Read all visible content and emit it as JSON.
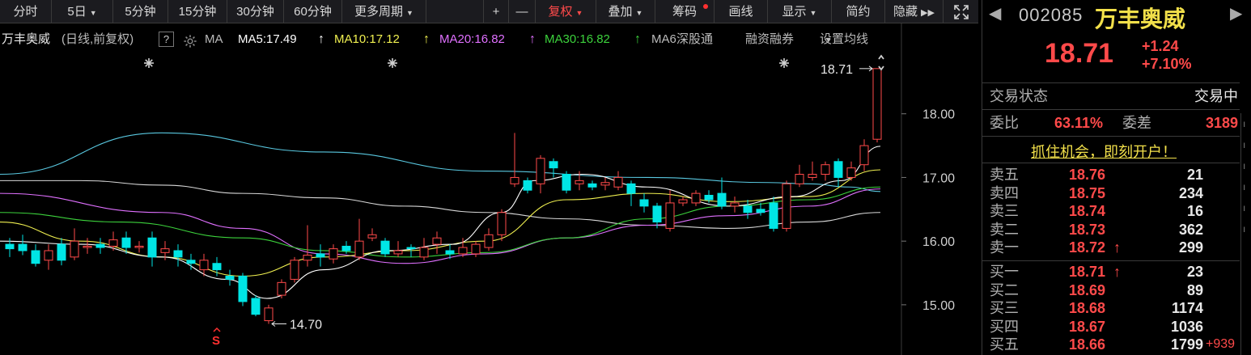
{
  "toolbar": {
    "items": [
      {
        "label": "分时"
      },
      {
        "label": "5日",
        "dropdown": true
      },
      {
        "label": "5分钟"
      },
      {
        "label": "15分钟"
      },
      {
        "label": "30分钟"
      },
      {
        "label": "60分钟"
      },
      {
        "label": "更多周期",
        "dropdown": true
      }
    ],
    "zoom_in": "+",
    "zoom_out": "—",
    "fuquan": "复权",
    "diejia": "叠加",
    "chouma": "筹码",
    "huaxian": "画线",
    "xianshi": "显示",
    "jianyue": "简约",
    "yincang": "隐藏",
    "fullscreen_icon": "fullscreen-icon"
  },
  "indicator_line": {
    "stock_name": "万丰奥威",
    "period_label": "(日线,前复权)",
    "help": "?",
    "ma_label": "MA",
    "ma5": "MA5:17.49",
    "ma10": "MA10:17.12",
    "ma20": "MA20:16.82",
    "ma30": "MA30:16.82",
    "ma6": "MA6",
    "shengutong": "深股通",
    "rongzi": "融资融券",
    "settings": "设置均线",
    "up_arrow": "↑"
  },
  "chart_data": {
    "type": "candlestick",
    "y_ticks": [
      "18.00",
      "17.00",
      "16.00",
      "15.00"
    ],
    "ylim": [
      14.3,
      19.0
    ],
    "high_label": "18.71",
    "low_label": "14.70",
    "signal_label": "S",
    "candles": [
      {
        "o": 15.95,
        "c": 15.88,
        "h": 16.05,
        "l": 15.75
      },
      {
        "o": 15.95,
        "c": 15.85,
        "h": 16.1,
        "l": 15.78
      },
      {
        "o": 15.85,
        "c": 15.65,
        "h": 15.95,
        "l": 15.6
      },
      {
        "o": 15.7,
        "c": 15.85,
        "h": 15.95,
        "l": 15.55
      },
      {
        "o": 15.95,
        "c": 15.7,
        "h": 16.05,
        "l": 15.62
      },
      {
        "o": 15.75,
        "c": 16.0,
        "h": 16.2,
        "l": 15.7
      },
      {
        "o": 15.9,
        "c": 15.92,
        "h": 16.05,
        "l": 15.8
      },
      {
        "o": 15.95,
        "c": 15.9,
        "h": 16.05,
        "l": 15.8
      },
      {
        "o": 15.92,
        "c": 16.02,
        "h": 16.15,
        "l": 15.85
      },
      {
        "o": 16.05,
        "c": 15.9,
        "h": 16.15,
        "l": 15.8
      },
      {
        "o": 15.9,
        "c": 15.92,
        "h": 16.0,
        "l": 15.82
      },
      {
        "o": 16.05,
        "c": 15.75,
        "h": 16.15,
        "l": 15.6
      },
      {
        "o": 15.82,
        "c": 15.88,
        "h": 16.0,
        "l": 15.7
      },
      {
        "o": 15.85,
        "c": 15.75,
        "h": 15.95,
        "l": 15.6
      },
      {
        "o": 15.7,
        "c": 15.65,
        "h": 15.8,
        "l": 15.55
      },
      {
        "o": 15.55,
        "c": 15.7,
        "h": 15.8,
        "l": 15.45
      },
      {
        "o": 15.65,
        "c": 15.55,
        "h": 15.75,
        "l": 15.45
      },
      {
        "o": 15.45,
        "c": 15.4,
        "h": 15.55,
        "l": 15.3
      },
      {
        "o": 15.45,
        "c": 15.05,
        "h": 15.5,
        "l": 14.98
      },
      {
        "o": 15.1,
        "c": 14.85,
        "h": 15.15,
        "l": 14.82
      },
      {
        "o": 14.75,
        "c": 14.95,
        "h": 15.0,
        "l": 14.7
      },
      {
        "o": 15.15,
        "c": 15.35,
        "h": 15.4,
        "l": 15.1
      },
      {
        "o": 15.4,
        "c": 15.7,
        "h": 15.75,
        "l": 15.35
      },
      {
        "o": 15.7,
        "c": 15.78,
        "h": 16.25,
        "l": 15.6
      },
      {
        "o": 15.8,
        "c": 15.75,
        "h": 15.95,
        "l": 15.6
      },
      {
        "o": 15.72,
        "c": 15.88,
        "h": 15.95,
        "l": 15.65
      },
      {
        "o": 15.92,
        "c": 15.85,
        "h": 16.0,
        "l": 15.8
      },
      {
        "o": 15.75,
        "c": 16.0,
        "h": 16.35,
        "l": 15.7
      },
      {
        "o": 16.05,
        "c": 16.1,
        "h": 16.2,
        "l": 16.0
      },
      {
        "o": 16.0,
        "c": 15.8,
        "h": 16.05,
        "l": 15.75
      },
      {
        "o": 15.8,
        "c": 15.85,
        "h": 16.0,
        "l": 15.75
      },
      {
        "o": 15.9,
        "c": 15.88,
        "h": 15.95,
        "l": 15.75
      },
      {
        "o": 15.75,
        "c": 15.9,
        "h": 16.05,
        "l": 15.7
      },
      {
        "o": 15.95,
        "c": 16.05,
        "h": 16.15,
        "l": 15.8
      },
      {
        "o": 15.85,
        "c": 15.8,
        "h": 15.95,
        "l": 15.72
      },
      {
        "o": 15.8,
        "c": 15.9,
        "h": 16.05,
        "l": 15.75
      },
      {
        "o": 15.8,
        "c": 15.95,
        "h": 16.0,
        "l": 15.75
      },
      {
        "o": 15.9,
        "c": 16.1,
        "h": 16.2,
        "l": 15.85
      },
      {
        "o": 16.1,
        "c": 16.45,
        "h": 16.5,
        "l": 16.0
      },
      {
        "o": 16.9,
        "c": 17.0,
        "h": 17.7,
        "l": 16.85
      },
      {
        "o": 16.95,
        "c": 16.8,
        "h": 17.0,
        "l": 16.75
      },
      {
        "o": 16.9,
        "c": 17.3,
        "h": 17.35,
        "l": 16.75
      },
      {
        "o": 17.25,
        "c": 17.15,
        "h": 17.3,
        "l": 17.0
      },
      {
        "o": 17.05,
        "c": 16.8,
        "h": 17.1,
        "l": 16.75
      },
      {
        "o": 16.9,
        "c": 16.95,
        "h": 17.1,
        "l": 16.8
      },
      {
        "o": 16.9,
        "c": 16.85,
        "h": 16.95,
        "l": 16.8
      },
      {
        "o": 16.88,
        "c": 16.92,
        "h": 17.0,
        "l": 16.8
      },
      {
        "o": 16.85,
        "c": 17.0,
        "h": 17.1,
        "l": 16.8
      },
      {
        "o": 16.9,
        "c": 16.75,
        "h": 16.95,
        "l": 16.55
      },
      {
        "o": 16.65,
        "c": 16.55,
        "h": 16.75,
        "l": 16.45
      },
      {
        "o": 16.55,
        "c": 16.3,
        "h": 16.6,
        "l": 16.2
      },
      {
        "o": 16.2,
        "c": 16.6,
        "h": 16.8,
        "l": 16.15
      },
      {
        "o": 16.6,
        "c": 16.65,
        "h": 16.7,
        "l": 16.55
      },
      {
        "o": 16.6,
        "c": 16.75,
        "h": 16.8,
        "l": 16.55
      },
      {
        "o": 16.72,
        "c": 16.65,
        "h": 16.8,
        "l": 16.6
      },
      {
        "o": 16.75,
        "c": 16.55,
        "h": 17.0,
        "l": 16.5
      },
      {
        "o": 16.55,
        "c": 16.6,
        "h": 16.7,
        "l": 16.45
      },
      {
        "o": 16.55,
        "c": 16.45,
        "h": 16.65,
        "l": 16.35
      },
      {
        "o": 16.5,
        "c": 16.45,
        "h": 16.6,
        "l": 16.4
      },
      {
        "o": 16.6,
        "c": 16.2,
        "h": 16.7,
        "l": 16.15
      },
      {
        "o": 16.2,
        "c": 16.9,
        "h": 16.95,
        "l": 16.15
      },
      {
        "o": 16.9,
        "c": 17.05,
        "h": 17.2,
        "l": 16.85
      },
      {
        "o": 17.0,
        "c": 17.05,
        "h": 17.25,
        "l": 16.95
      },
      {
        "o": 17.05,
        "c": 17.2,
        "h": 17.25,
        "l": 16.95
      },
      {
        "o": 17.25,
        "c": 17.0,
        "h": 17.3,
        "l": 16.85
      },
      {
        "o": 17.0,
        "c": 17.15,
        "h": 17.25,
        "l": 16.95
      },
      {
        "o": 17.2,
        "c": 17.5,
        "h": 17.6,
        "l": 17.1
      },
      {
        "o": 17.6,
        "c": 18.71,
        "h": 18.71,
        "l": 17.55
      }
    ],
    "ma_series": [
      {
        "color": "#59c8e0",
        "points": [
          [
            0,
            17.05
          ],
          [
            200,
            17.7
          ],
          [
            400,
            17.4
          ],
          [
            600,
            17.1
          ],
          [
            800,
            17.0
          ],
          [
            950,
            16.92
          ],
          [
            1000,
            16.9
          ],
          [
            1050,
            16.85
          ],
          [
            1088,
            16.78
          ]
        ]
      },
      {
        "color": "#d8d8d8",
        "points": [
          [
            0,
            16.95
          ],
          [
            100,
            16.95
          ],
          [
            200,
            16.88
          ],
          [
            300,
            16.75
          ],
          [
            400,
            16.68
          ],
          [
            500,
            16.55
          ],
          [
            600,
            16.45
          ],
          [
            700,
            16.35
          ],
          [
            800,
            16.25
          ],
          [
            900,
            16.2
          ],
          [
            1000,
            16.3
          ],
          [
            1088,
            16.45
          ]
        ]
      },
      {
        "color": "#e070ff",
        "points": [
          [
            0,
            16.75
          ],
          [
            200,
            16.45
          ],
          [
            300,
            16.2
          ],
          [
            400,
            15.8
          ],
          [
            500,
            15.65
          ],
          [
            600,
            15.8
          ],
          [
            700,
            16.05
          ],
          [
            800,
            16.25
          ],
          [
            900,
            16.4
          ],
          [
            1000,
            16.55
          ],
          [
            1088,
            16.82
          ]
        ]
      },
      {
        "color": "#3cd23c",
        "points": [
          [
            0,
            16.45
          ],
          [
            150,
            16.3
          ],
          [
            300,
            16.05
          ],
          [
            400,
            15.85
          ],
          [
            500,
            15.75
          ],
          [
            600,
            15.82
          ],
          [
            700,
            16.05
          ],
          [
            800,
            16.35
          ],
          [
            900,
            16.55
          ],
          [
            1000,
            16.65
          ],
          [
            1088,
            16.85
          ]
        ]
      },
      {
        "color": "#f0f050",
        "points": [
          [
            0,
            16.3
          ],
          [
            100,
            16.0
          ],
          [
            200,
            15.75
          ],
          [
            300,
            15.45
          ],
          [
            400,
            15.75
          ],
          [
            500,
            15.85
          ],
          [
            600,
            16.0
          ],
          [
            700,
            16.65
          ],
          [
            800,
            16.75
          ],
          [
            900,
            16.62
          ],
          [
            1000,
            16.7
          ],
          [
            1088,
            17.12
          ]
        ]
      },
      {
        "color": "#ffffff",
        "points": [
          [
            0,
            16.0
          ],
          [
            100,
            15.95
          ],
          [
            200,
            15.75
          ],
          [
            280,
            15.4
          ],
          [
            330,
            15.1
          ],
          [
            400,
            15.55
          ],
          [
            480,
            15.85
          ],
          [
            560,
            15.95
          ],
          [
            620,
            16.45
          ],
          [
            660,
            16.95
          ],
          [
            720,
            17.05
          ],
          [
            800,
            16.85
          ],
          [
            900,
            16.55
          ],
          [
            980,
            16.7
          ],
          [
            1040,
            16.95
          ],
          [
            1088,
            17.49
          ]
        ]
      }
    ]
  },
  "quote": {
    "code": "002085",
    "name": "万丰奥威",
    "price": "18.71",
    "change": "+1.24",
    "pct": "+7.10%"
  },
  "status": {
    "label": "交易状态",
    "value": "交易中",
    "weibi_label": "委比",
    "weibi_value": "63.11%",
    "weicha_label": "委差",
    "weicha_value": "3189"
  },
  "promo": "抓住机会，即刻开户！",
  "asks": [
    {
      "label": "卖五",
      "price": "18.76",
      "vol": "21"
    },
    {
      "label": "卖四",
      "price": "18.75",
      "vol": "234"
    },
    {
      "label": "卖三",
      "price": "18.74",
      "vol": "16"
    },
    {
      "label": "卖二",
      "price": "18.73",
      "vol": "362"
    },
    {
      "label": "卖一",
      "price": "18.72",
      "vol": "299",
      "arrow": "↑"
    }
  ],
  "bids": [
    {
      "label": "买一",
      "price": "18.71",
      "vol": "23",
      "arrow": "↑"
    },
    {
      "label": "买二",
      "price": "18.69",
      "vol": "89"
    },
    {
      "label": "买三",
      "price": "18.68",
      "vol": "1174"
    },
    {
      "label": "买四",
      "price": "18.67",
      "vol": "1036"
    },
    {
      "label": "买五",
      "price": "18.66",
      "vol": "1799",
      "extra": "+939"
    }
  ],
  "colors": {
    "up": "#ff4a4a",
    "down": "#00e5e5",
    "bg": "#000000"
  }
}
